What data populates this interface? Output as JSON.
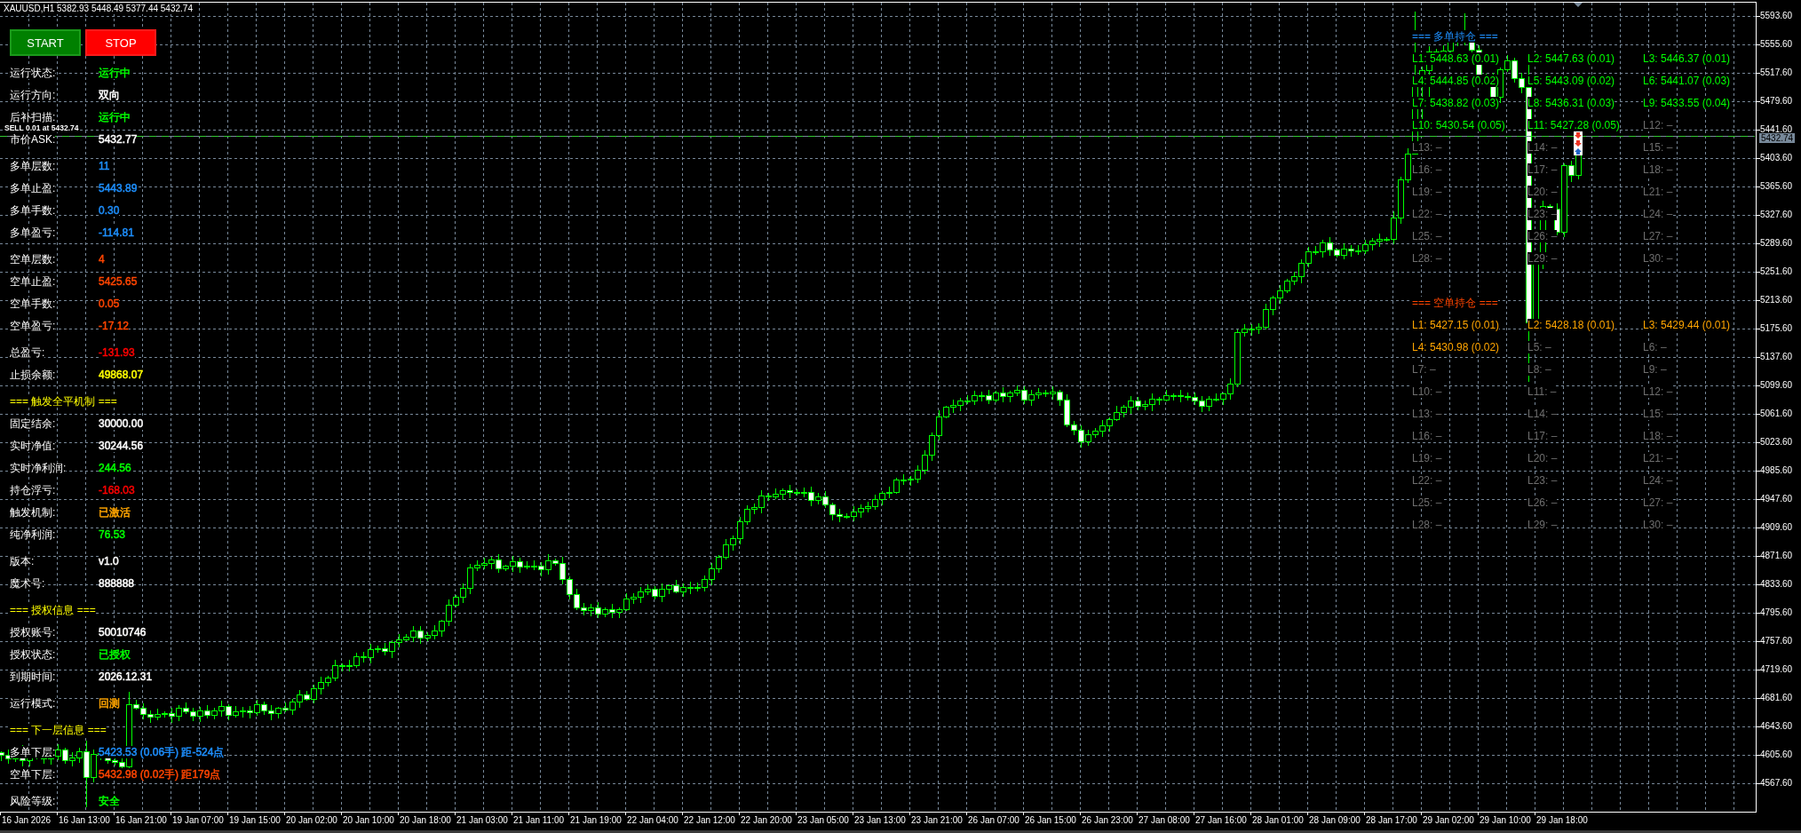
{
  "chart": {
    "symbol_info": "XAUUSD,H1 5382.93 5448.49 5377.44 5432.74",
    "order_label": "SELL 0.01 at 5432.74",
    "current_price": "5432.74"
  },
  "buttons": [
    {
      "label": "START",
      "kind": "start"
    },
    {
      "label": "STOP",
      "kind": "stop"
    }
  ],
  "panel": {
    "sections": [
      {
        "rows": [
          {
            "label": "运行状态:",
            "value": "运行中",
            "color": "#00ff00"
          },
          {
            "label": "运行方向:",
            "value": "双向",
            "color": "#ffffff"
          },
          {
            "label": "后补扫描:",
            "value": "运行中",
            "color": "#00ff00"
          },
          {
            "label": "市价ASK:",
            "value": "5432.77",
            "color": "#ffffff"
          }
        ]
      },
      {
        "rows": [
          {
            "label": "多单层数:",
            "value": "11",
            "color": "#1e90ff"
          },
          {
            "label": "多单止盈:",
            "value": "5443.89",
            "color": "#1e90ff"
          },
          {
            "label": "多单手数:",
            "value": "0.30",
            "color": "#1e90ff"
          },
          {
            "label": "多单盈亏:",
            "value": "-114.81",
            "color": "#1e90ff"
          }
        ]
      },
      {
        "rows": [
          {
            "label": "空单层数:",
            "value": "4",
            "color": "#ff4500"
          },
          {
            "label": "空单止盈:",
            "value": "5425.65",
            "color": "#ff4500"
          },
          {
            "label": "空单手数:",
            "value": "0.05",
            "color": "#ff4500"
          },
          {
            "label": "空单盈亏:",
            "value": "-17.12",
            "color": "#ff4500"
          }
        ]
      },
      {
        "rows": [
          {
            "label": "总盈亏:",
            "value": "-131.93",
            "color": "#ff0000"
          },
          {
            "label": "止损余额:",
            "value": "49868.07",
            "color": "#ffff00"
          }
        ]
      },
      {
        "title": "=== 触发全平机制 ===",
        "rows": [
          {
            "label": "固定结余:",
            "value": "30000.00",
            "color": "#ffffff"
          },
          {
            "label": "实时净值:",
            "value": "30244.56",
            "color": "#ffffff"
          },
          {
            "label": "实时净利润:",
            "value": "244.56",
            "color": "#00ff00"
          },
          {
            "label": "持仓浮亏:",
            "value": "-168.03",
            "color": "#ff0000"
          },
          {
            "label": "触发机制:",
            "value": "已激活",
            "color": "#ffa500"
          },
          {
            "label": "纯净利润:",
            "value": "76.53",
            "color": "#00ff00"
          }
        ]
      },
      {
        "rows": [
          {
            "label": "版本:",
            "value": "v1.0",
            "color": "#ffffff"
          },
          {
            "label": "魔术号:",
            "value": "888888",
            "color": "#ffffff"
          }
        ]
      },
      {
        "title": "=== 授权信息 ===",
        "rows": [
          {
            "label": "授权账号:",
            "value": "50010746",
            "color": "#ffffff"
          },
          {
            "label": "授权状态:",
            "value": "已授权",
            "color": "#00ff00"
          },
          {
            "label": "到期时间:",
            "value": "2026.12.31",
            "color": "#ffffff"
          }
        ]
      },
      {
        "rows": [
          {
            "label": "运行模式:",
            "value": "回测",
            "color": "#ffa500"
          }
        ]
      },
      {
        "title": "=== 下一层信息 ===",
        "rows": [
          {
            "label": "多单下层:",
            "value": "5423.53 (0.06手) 距-524点",
            "color": "#1e90ff"
          },
          {
            "label": "空单下层:",
            "value": "5432.98 (0.02手) 距179点",
            "color": "#ff4500"
          }
        ]
      },
      {
        "rows": [
          {
            "label": "风险等级:",
            "value": "安全",
            "color": "#00ff00"
          }
        ]
      }
    ]
  },
  "positions": [
    {
      "title": "=== 多单持仓 ===",
      "kind": "long",
      "levels": [
        {
          "label": "L1: 5448.63 (0.01)",
          "active": true
        },
        {
          "label": "L2: 5447.63 (0.01)",
          "active": true
        },
        {
          "label": "L3: 5446.37 (0.01)",
          "active": true
        },
        {
          "label": "L4: 5444.85 (0.02)",
          "active": true
        },
        {
          "label": "L5: 5443.09 (0.02)",
          "active": true
        },
        {
          "label": "L6: 5441.07 (0.03)",
          "active": true
        },
        {
          "label": "L7: 5438.82 (0.03)",
          "active": true
        },
        {
          "label": "L8: 5436.31 (0.03)",
          "active": true
        },
        {
          "label": "L9: 5433.55 (0.04)",
          "active": true
        },
        {
          "label": "L10: 5430.54 (0.05)",
          "active": true
        },
        {
          "label": "L11: 5427.28 (0.05)",
          "active": true
        },
        {
          "label": "L12: –",
          "active": false
        },
        {
          "label": "L13: –",
          "active": false
        },
        {
          "label": "L14: –",
          "active": false
        },
        {
          "label": "L15: –",
          "active": false
        },
        {
          "label": "L16: –",
          "active": false
        },
        {
          "label": "L17: –",
          "active": false
        },
        {
          "label": "L18: –",
          "active": false
        },
        {
          "label": "L19: –",
          "active": false
        },
        {
          "label": "L20: –",
          "active": false
        },
        {
          "label": "L21: –",
          "active": false
        },
        {
          "label": "L22: –",
          "active": false
        },
        {
          "label": "L23: –",
          "active": false
        },
        {
          "label": "L24: –",
          "active": false
        },
        {
          "label": "L25: –",
          "active": false
        },
        {
          "label": "L26: –",
          "active": false
        },
        {
          "label": "L27: –",
          "active": false
        },
        {
          "label": "L28: –",
          "active": false
        },
        {
          "label": "L29: –",
          "active": false
        },
        {
          "label": "L30: –",
          "active": false
        }
      ]
    },
    {
      "title": "=== 空单持仓 ===",
      "kind": "short",
      "levels": [
        {
          "label": "L1: 5427.15 (0.01)",
          "active": true
        },
        {
          "label": "L2: 5428.18 (0.01)",
          "active": true
        },
        {
          "label": "L3: 5429.44 (0.01)",
          "active": true
        },
        {
          "label": "L4: 5430.98 (0.02)",
          "active": true
        },
        {
          "label": "L5: –",
          "active": false
        },
        {
          "label": "L6: –",
          "active": false
        },
        {
          "label": "L7: –",
          "active": false
        },
        {
          "label": "L8: –",
          "active": false
        },
        {
          "label": "L9: –",
          "active": false
        },
        {
          "label": "L10: –",
          "active": false
        },
        {
          "label": "L11: –",
          "active": false
        },
        {
          "label": "L12: –",
          "active": false
        },
        {
          "label": "L13: –",
          "active": false
        },
        {
          "label": "L14: –",
          "active": false
        },
        {
          "label": "L15: –",
          "active": false
        },
        {
          "label": "L16: –",
          "active": false
        },
        {
          "label": "L17: –",
          "active": false
        },
        {
          "label": "L18: –",
          "active": false
        },
        {
          "label": "L19: –",
          "active": false
        },
        {
          "label": "L20: –",
          "active": false
        },
        {
          "label": "L21: –",
          "active": false
        },
        {
          "label": "L22: –",
          "active": false
        },
        {
          "label": "L23: –",
          "active": false
        },
        {
          "label": "L24: –",
          "active": false
        },
        {
          "label": "L25: –",
          "active": false
        },
        {
          "label": "L26: –",
          "active": false
        },
        {
          "label": "L27: –",
          "active": false
        },
        {
          "label": "L28: –",
          "active": false
        },
        {
          "label": "L29: –",
          "active": false
        },
        {
          "label": "L30: –",
          "active": false
        }
      ]
    }
  ],
  "price_axis": {
    "labels": [
      "5593.60",
      "5555.60",
      "5517.60",
      "5479.60",
      "5441.60",
      "5403.60",
      "5365.60",
      "5327.60",
      "5289.60",
      "5251.60",
      "5213.60",
      "5175.60",
      "5137.60",
      "5099.60",
      "5061.60",
      "5023.60",
      "4985.60",
      "4947.60",
      "4909.60",
      "4871.60",
      "4833.60",
      "4795.60",
      "4757.60",
      "4719.60",
      "4681.60",
      "4643.60",
      "4605.60",
      "4567.60"
    ]
  },
  "time_axis": {
    "labels": [
      "16 Jan 2026",
      "16 Jan 13:00",
      "16 Jan 21:00",
      "19 Jan 07:00",
      "19 Jan 15:00",
      "20 Jan 02:00",
      "20 Jan 10:00",
      "20 Jan 18:00",
      "21 Jan 03:00",
      "21 Jan 11:00",
      "21 Jan 19:00",
      "22 Jan 04:00",
      "22 Jan 12:00",
      "22 Jan 20:00",
      "23 Jan 05:00",
      "23 Jan 13:00",
      "23 Jan 21:00",
      "26 Jan 07:00",
      "26 Jan 15:00",
      "26 Jan 23:00",
      "27 Jan 08:00",
      "27 Jan 16:00",
      "28 Jan 01:00",
      "28 Jan 09:00",
      "28 Jan 17:00",
      "29 Jan 02:00",
      "29 Jan 10:00",
      "29 Jan 18:00"
    ]
  }
}
